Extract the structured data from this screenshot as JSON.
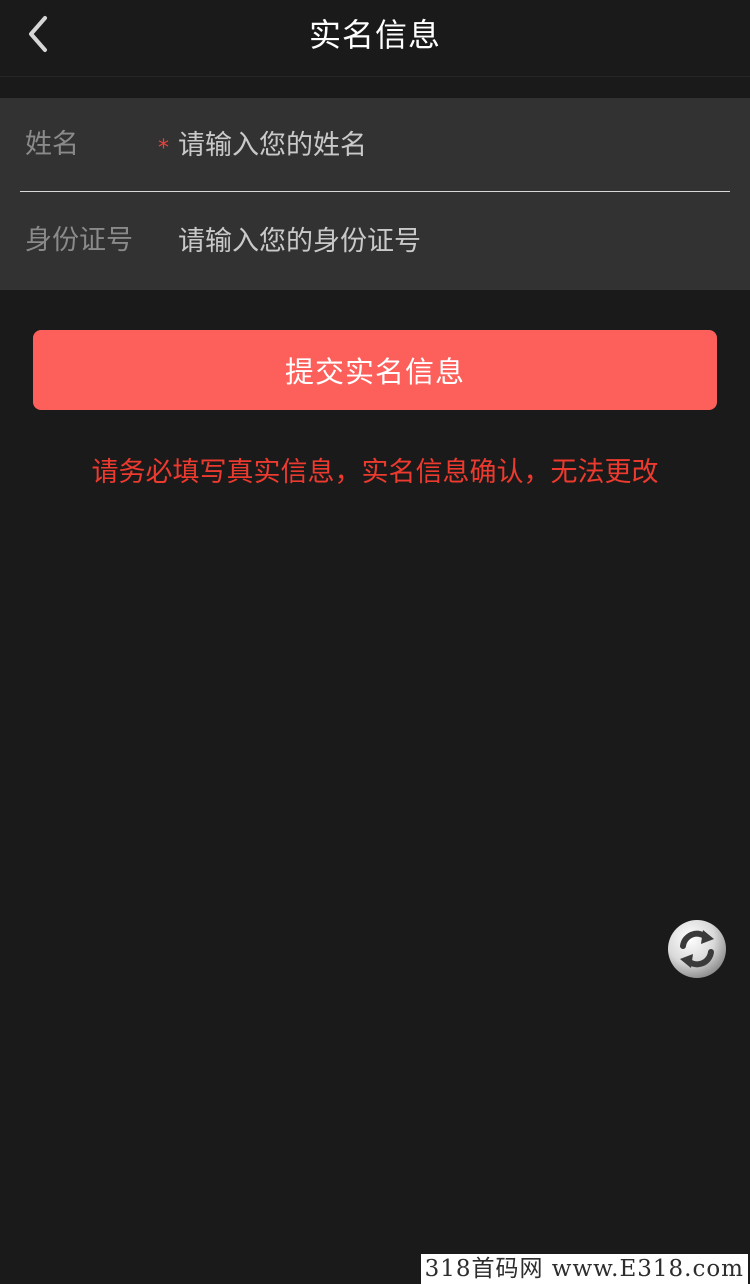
{
  "nav": {
    "back_icon": "chevron-left-icon",
    "title": "实名信息"
  },
  "form": {
    "name": {
      "label": "姓名",
      "required_mark": "*",
      "placeholder": "请输入您的姓名",
      "value": ""
    },
    "id_number": {
      "label": "身份证号",
      "placeholder": "请输入您的身份证号",
      "value": ""
    }
  },
  "submit_label": "提交实名信息",
  "notice": "请务必填写真实信息，实名信息确认，无法更改",
  "floating": {
    "icon": "refresh-icon"
  },
  "watermark": "318首码网 www.E318.com",
  "colors": {
    "background": "#1a1a1a",
    "card": "#323232",
    "accent": "#fd5f5b",
    "notice": "#ec3a2f",
    "required": "#e8443c"
  }
}
